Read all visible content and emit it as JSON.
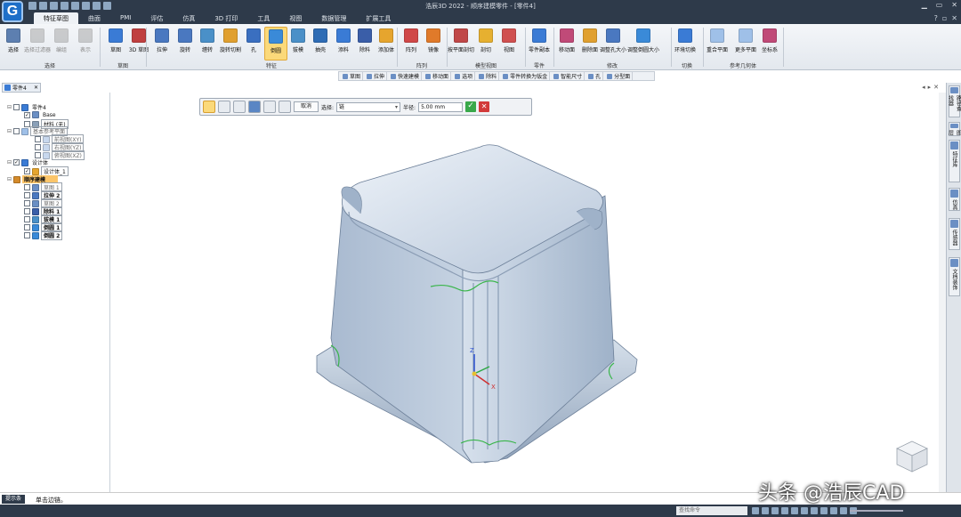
{
  "title": "浩辰3D 2022 - 顺序建模零件 - [零件4]",
  "menus": [
    {
      "label": "特征草图",
      "active": true
    },
    {
      "label": "曲面"
    },
    {
      "label": "PMI"
    },
    {
      "label": "评估"
    },
    {
      "label": "仿真"
    },
    {
      "label": "3D 打印"
    },
    {
      "label": "工具"
    },
    {
      "label": "视图"
    },
    {
      "label": "数据管理"
    },
    {
      "label": "扩展工具"
    }
  ],
  "ribbon": {
    "buttons": [
      {
        "label": "选择",
        "color": "#5d7fb0"
      },
      {
        "label": "选择过滤器",
        "color": "#9a9a9a",
        "disabled": true
      },
      {
        "label": "编组",
        "color": "#9a9a9a",
        "disabled": true
      },
      {
        "label": "表示",
        "color": "#9a9a9a",
        "disabled": true
      },
      {
        "label": "草图",
        "color": "#3a7bd5"
      },
      {
        "label": "3D\n草图",
        "color": "#c04040"
      },
      {
        "label": "拉伸",
        "color": "#4a78c0"
      },
      {
        "label": "旋转",
        "color": "#4a78c0"
      },
      {
        "label": "缠转",
        "color": "#4a90c8"
      },
      {
        "label": "旋转切割",
        "color": "#e0a030"
      },
      {
        "label": "孔",
        "color": "#3a6fc0"
      },
      {
        "label": "倒圆",
        "color": "#3a8ad8",
        "selected": true
      },
      {
        "label": "拔模",
        "color": "#4a90c8"
      },
      {
        "label": "抽壳",
        "color": "#2e6cb5"
      },
      {
        "label": "添料",
        "color": "#3a7bd5"
      },
      {
        "label": "除料",
        "color": "#3a5ea8"
      },
      {
        "label": "添加体",
        "color": "#e6a52e"
      },
      {
        "label": "阵列",
        "color": "#d04848"
      },
      {
        "label": "镜像",
        "color": "#e07a2a"
      },
      {
        "label": "按平面剖切",
        "color": "#c04848"
      },
      {
        "label": "剖切",
        "color": "#e6b030"
      },
      {
        "label": "视图",
        "color": "#d05050"
      },
      {
        "label": "零件副本",
        "color": "#3a7bd5"
      },
      {
        "label": "移动面",
        "color": "#c04a78"
      },
      {
        "label": "删除面",
        "color": "#e0a030"
      },
      {
        "label": "调整孔大小",
        "color": "#4a78c0"
      },
      {
        "label": "调整倒圆大小",
        "color": "#3a8ad8"
      },
      {
        "label": "环境切换",
        "color": "#3a7bd5"
      },
      {
        "label": "重合平面",
        "color": "#9fc0e8"
      },
      {
        "label": "更多平面",
        "color": "#9fc0e8"
      },
      {
        "label": "坐标系",
        "color": "#c04a78"
      }
    ],
    "groups": [
      "选择",
      "草图",
      "特征",
      "阵列",
      "模型视图",
      "零件",
      "修改",
      "切换",
      "参考几何体"
    ]
  },
  "command_bar": [
    "草图",
    "拉伸",
    "快速建模",
    "移动面",
    "选项",
    "除料",
    "零件转换为钣金",
    "智能尺寸",
    "孔",
    "分型面"
  ],
  "doc_tab": "零件4",
  "tree": [
    {
      "level": 0,
      "label": "零件4",
      "expand": "⊟",
      "check": "",
      "color": "#3a7bd5"
    },
    {
      "level": 1,
      "label": "Base",
      "expand": "",
      "check": "✓",
      "color": "#6b8fc4"
    },
    {
      "level": 1,
      "label": "材料 (无)",
      "expand": "",
      "check": "",
      "color": "#8aa0b8",
      "style": "box"
    },
    {
      "level": 0,
      "label": "基本参考平面",
      "expand": "⊟",
      "check": "",
      "color": "#9fc0e8",
      "style": "box gray"
    },
    {
      "level": 2,
      "label": "前视图(XY)",
      "expand": "",
      "check": "",
      "color": "#c8d8ee",
      "style": "box gray"
    },
    {
      "level": 2,
      "label": "右视图(YZ)",
      "expand": "",
      "check": "",
      "color": "#c8d8ee",
      "style": "box gray"
    },
    {
      "level": 2,
      "label": "俯视图(XZ)",
      "expand": "",
      "check": "",
      "color": "#c8d8ee",
      "style": "box gray"
    },
    {
      "level": 0,
      "label": "设计体",
      "expand": "⊟",
      "check": "✓",
      "color": "#3a7bd5"
    },
    {
      "level": 1,
      "label": "设计体_1",
      "expand": "",
      "check": "✓",
      "color": "#e6a52e",
      "style": "box"
    },
    {
      "level": 0,
      "label": "顺序建模",
      "expand": "⊟",
      "check": "",
      "color": "#d48a2a",
      "style": "hl"
    },
    {
      "level": 1,
      "label": "草图 1",
      "expand": "",
      "check": "",
      "color": "#6b8fc4",
      "style": "box gray"
    },
    {
      "level": 1,
      "label": "拉伸 2",
      "expand": "",
      "check": "",
      "color": "#4a78c0",
      "style": "box bold"
    },
    {
      "level": 1,
      "label": "草图 2",
      "expand": "",
      "check": "",
      "color": "#6b8fc4",
      "style": "box gray"
    },
    {
      "level": 1,
      "label": "除料 1",
      "expand": "",
      "check": "",
      "color": "#3a5ea8",
      "style": "box bold"
    },
    {
      "level": 1,
      "label": "拔模 1",
      "expand": "",
      "check": "",
      "color": "#4a90c8",
      "style": "box bold"
    },
    {
      "level": 1,
      "label": "倒圆 1",
      "expand": "",
      "check": "",
      "color": "#3a8ad8",
      "style": "box bold"
    },
    {
      "level": 1,
      "label": "倒圆 2",
      "expand": "",
      "check": "",
      "color": "#3a8ad8",
      "style": "box bold"
    }
  ],
  "fillet_bar": {
    "cancel": "取消",
    "select_label": "选择:",
    "select_value": "链",
    "radius_label": "半径:",
    "radius_value": "5.00 mm"
  },
  "right_tabs": [
    "路径查找器",
    "图层",
    "特征库",
    "仿真",
    "传感器",
    "文档装饰"
  ],
  "status": {
    "prompt_btn": "提示条",
    "prompt": "单击边链。",
    "find_placeholder": "查找命令"
  },
  "watermark": "头条 @浩辰CAD",
  "colors": {
    "titlebar": "#2e3a4a",
    "accent": "#3a7bd5",
    "highlight": "#fbc56a"
  }
}
